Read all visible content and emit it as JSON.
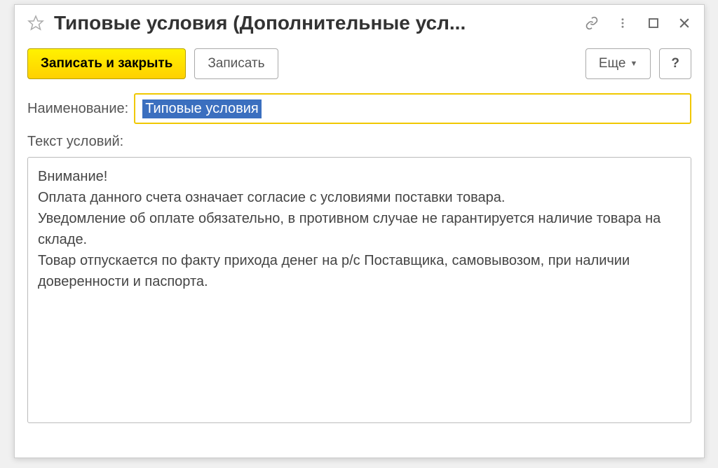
{
  "window": {
    "title": "Типовые условия (Дополнительные усл..."
  },
  "toolbar": {
    "save_and_close": "Записать и закрыть",
    "save": "Записать",
    "more": "Еще",
    "help": "?"
  },
  "form": {
    "name_label": "Наименование:",
    "name_value": "Типовые условия",
    "conditions_label": "Текст условий:",
    "conditions_text": "Внимание!\nОплата данного счета означает согласие с условиями поставки товара.\nУведомление об оплате обязательно, в противном случае не гарантируется наличие товара на складе.\nТовар отпускается по факту прихода денег на р/с Поставщика, самовывозом, при наличии доверенности и паспорта."
  }
}
